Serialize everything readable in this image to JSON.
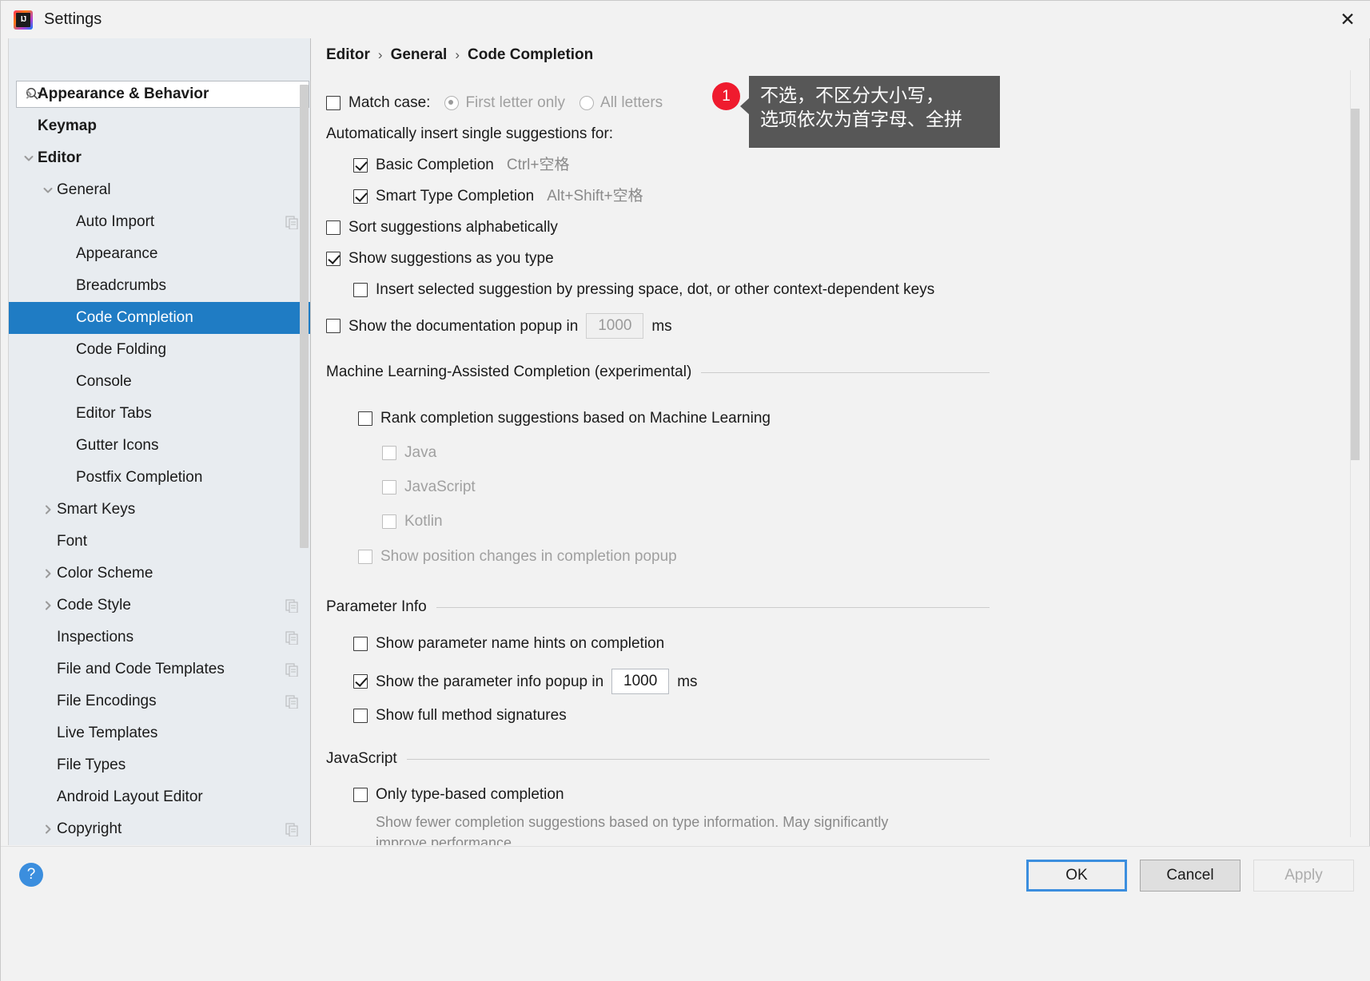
{
  "window": {
    "title": "Settings",
    "app_icon": "intellij-idea-icon",
    "close_icon": "close-icon"
  },
  "search": {
    "placeholder": "",
    "value": "",
    "icon": "search-icon"
  },
  "sidebar": {
    "items": [
      {
        "label": "Appearance & Behavior",
        "indent": 0,
        "arrow": "collapsed",
        "bold": true,
        "selected": false,
        "badge": false
      },
      {
        "label": "Keymap",
        "indent": 0,
        "arrow": "none",
        "bold": true,
        "selected": false,
        "badge": false
      },
      {
        "label": "Editor",
        "indent": 0,
        "arrow": "expanded",
        "bold": true,
        "selected": false,
        "badge": false
      },
      {
        "label": "General",
        "indent": 1,
        "arrow": "expanded",
        "bold": false,
        "selected": false,
        "badge": false
      },
      {
        "label": "Auto Import",
        "indent": 2,
        "arrow": "none",
        "bold": false,
        "selected": false,
        "badge": true
      },
      {
        "label": "Appearance",
        "indent": 2,
        "arrow": "none",
        "bold": false,
        "selected": false,
        "badge": false
      },
      {
        "label": "Breadcrumbs",
        "indent": 2,
        "arrow": "none",
        "bold": false,
        "selected": false,
        "badge": false
      },
      {
        "label": "Code Completion",
        "indent": 2,
        "arrow": "none",
        "bold": false,
        "selected": true,
        "badge": false
      },
      {
        "label": "Code Folding",
        "indent": 2,
        "arrow": "none",
        "bold": false,
        "selected": false,
        "badge": false
      },
      {
        "label": "Console",
        "indent": 2,
        "arrow": "none",
        "bold": false,
        "selected": false,
        "badge": false
      },
      {
        "label": "Editor Tabs",
        "indent": 2,
        "arrow": "none",
        "bold": false,
        "selected": false,
        "badge": false
      },
      {
        "label": "Gutter Icons",
        "indent": 2,
        "arrow": "none",
        "bold": false,
        "selected": false,
        "badge": false
      },
      {
        "label": "Postfix Completion",
        "indent": 2,
        "arrow": "none",
        "bold": false,
        "selected": false,
        "badge": false
      },
      {
        "label": "Smart Keys",
        "indent": 1,
        "arrow": "collapsed",
        "bold": false,
        "selected": false,
        "badge": false
      },
      {
        "label": "Font",
        "indent": 1,
        "arrow": "none",
        "bold": false,
        "selected": false,
        "badge": false
      },
      {
        "label": "Color Scheme",
        "indent": 1,
        "arrow": "collapsed",
        "bold": false,
        "selected": false,
        "badge": false
      },
      {
        "label": "Code Style",
        "indent": 1,
        "arrow": "collapsed",
        "bold": false,
        "selected": false,
        "badge": true
      },
      {
        "label": "Inspections",
        "indent": 1,
        "arrow": "none",
        "bold": false,
        "selected": false,
        "badge": true
      },
      {
        "label": "File and Code Templates",
        "indent": 1,
        "arrow": "none",
        "bold": false,
        "selected": false,
        "badge": true
      },
      {
        "label": "File Encodings",
        "indent": 1,
        "arrow": "none",
        "bold": false,
        "selected": false,
        "badge": true
      },
      {
        "label": "Live Templates",
        "indent": 1,
        "arrow": "none",
        "bold": false,
        "selected": false,
        "badge": false
      },
      {
        "label": "File Types",
        "indent": 1,
        "arrow": "none",
        "bold": false,
        "selected": false,
        "badge": false
      },
      {
        "label": "Android Layout Editor",
        "indent": 1,
        "arrow": "none",
        "bold": false,
        "selected": false,
        "badge": false
      },
      {
        "label": "Copyright",
        "indent": 1,
        "arrow": "collapsed",
        "bold": false,
        "selected": false,
        "badge": true
      }
    ]
  },
  "breadcrumb": {
    "part1": "Editor",
    "part2": "General",
    "part3": "Code Completion",
    "separator": "›"
  },
  "main": {
    "match_case": {
      "label": "Match case:",
      "checked": false,
      "options": [
        {
          "label": "First letter only",
          "selected": true
        },
        {
          "label": "All letters",
          "selected": false
        }
      ]
    },
    "auto_insert_header": "Automatically insert single suggestions for:",
    "basic_completion": {
      "label": "Basic Completion",
      "shortcut": "Ctrl+空格",
      "checked": true
    },
    "smart_type_completion": {
      "label": "Smart Type Completion",
      "shortcut": "Alt+Shift+空格",
      "checked": true
    },
    "sort_alphabetically": {
      "label": "Sort suggestions alphabetically",
      "checked": false
    },
    "show_as_you_type": {
      "label": "Show suggestions as you type",
      "checked": true
    },
    "insert_selected": {
      "label": "Insert selected suggestion by pressing space, dot, or other context-dependent keys",
      "checked": false
    },
    "doc_popup": {
      "label": "Show the documentation popup in",
      "checked": false,
      "value": "1000",
      "unit": "ms",
      "disabled": true
    },
    "ml_section": {
      "title": "Machine Learning-Assisted Completion (experimental)",
      "rank": {
        "label": "Rank completion suggestions based on Machine Learning",
        "checked": false
      },
      "languages": [
        {
          "label": "Java",
          "checked": false,
          "disabled": true
        },
        {
          "label": "JavaScript",
          "checked": false,
          "disabled": true
        },
        {
          "label": "Kotlin",
          "checked": false,
          "disabled": true
        }
      ],
      "position_changes": {
        "label": "Show position changes in completion popup",
        "checked": false,
        "disabled": true
      }
    },
    "parameter_info": {
      "title": "Parameter Info",
      "name_hints": {
        "label": "Show parameter name hints on completion",
        "checked": false
      },
      "popup_delay": {
        "label": "Show the parameter info popup in",
        "checked": true,
        "value": "1000",
        "unit": "ms",
        "disabled": false
      },
      "full_signatures": {
        "label": "Show full method signatures",
        "checked": false
      }
    },
    "javascript": {
      "title": "JavaScript",
      "type_based": {
        "label": "Only type-based completion",
        "checked": false
      },
      "description": "Show fewer completion suggestions based on type information. May significantly improve performance."
    }
  },
  "annotation": {
    "number": "1",
    "text_line1": "不选，不区分大小写，",
    "text_line2": "选项依次为首字母、全拼",
    "color": "#ef1b2e"
  },
  "footer": {
    "help_label": "?",
    "ok_label": "OK",
    "cancel_label": "Cancel",
    "apply_label": "Apply"
  },
  "colors": {
    "selection": "#1f7cc4",
    "accent": "#3b8ede",
    "annotation": "#ef1b2e"
  }
}
